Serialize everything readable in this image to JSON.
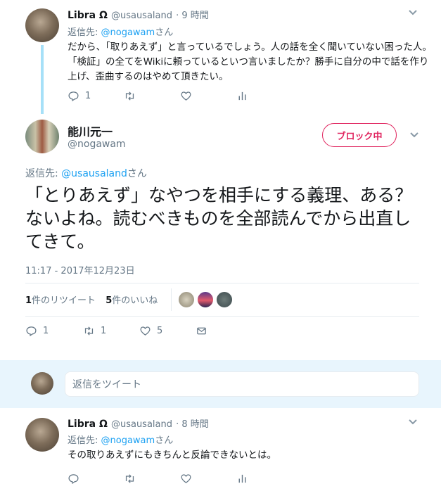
{
  "tweet1": {
    "name": "Libra ",
    "omega": "Ω",
    "handle": "@usausaland",
    "time": "· 9 時間",
    "reply_prefix": "返信先: ",
    "reply_handle": "@nogawam",
    "reply_suffix": "さん",
    "text": "だから、「取りあえず」と言っているでしょう。人の話を全く聞いていない困った人。「検証」の全てをWikiに頼っているといつ言いましたか？勝手に自分の中で話を作り上げ、歪曲するのはやめて頂きたい。",
    "reply_count": "1"
  },
  "main_tweet": {
    "name": "能川元一",
    "handle": "@nogawam",
    "block_label": "ブロック中",
    "reply_prefix": "返信先: ",
    "reply_handle": "@usausaland",
    "reply_suffix": "さん",
    "text": "「とりあえず」なやつを相手にする義理、ある？　ないよね。読むべきものを全部読んでから出直してきて。",
    "timestamp": "11:17 - 2017年12月23日",
    "retweets_num": "1",
    "retweets_label": "件のリツイート",
    "likes_num": "5",
    "likes_label": "件のいいね",
    "reply_count": "1",
    "retweet_count": "1",
    "like_count": "5"
  },
  "reply_composer": {
    "placeholder": "返信をツイート"
  },
  "tweet2": {
    "name": "Libra ",
    "omega": "Ω",
    "handle": "@usausaland",
    "time": "· 8 時間",
    "reply_prefix": "返信先: ",
    "reply_handle": "@nogawam",
    "reply_suffix": "さん",
    "text": "その取りあえずにもきちんと反論できないとは。"
  },
  "icons": {
    "reply": "reply-icon",
    "retweet": "retweet-icon",
    "like": "heart-icon",
    "analytics": "analytics-icon",
    "dm": "envelope-icon",
    "caret": "chevron-down-icon"
  },
  "colors": {
    "link": "#1da1f2",
    "block": "#e0245e",
    "thread_line": "#a6e0f8"
  }
}
